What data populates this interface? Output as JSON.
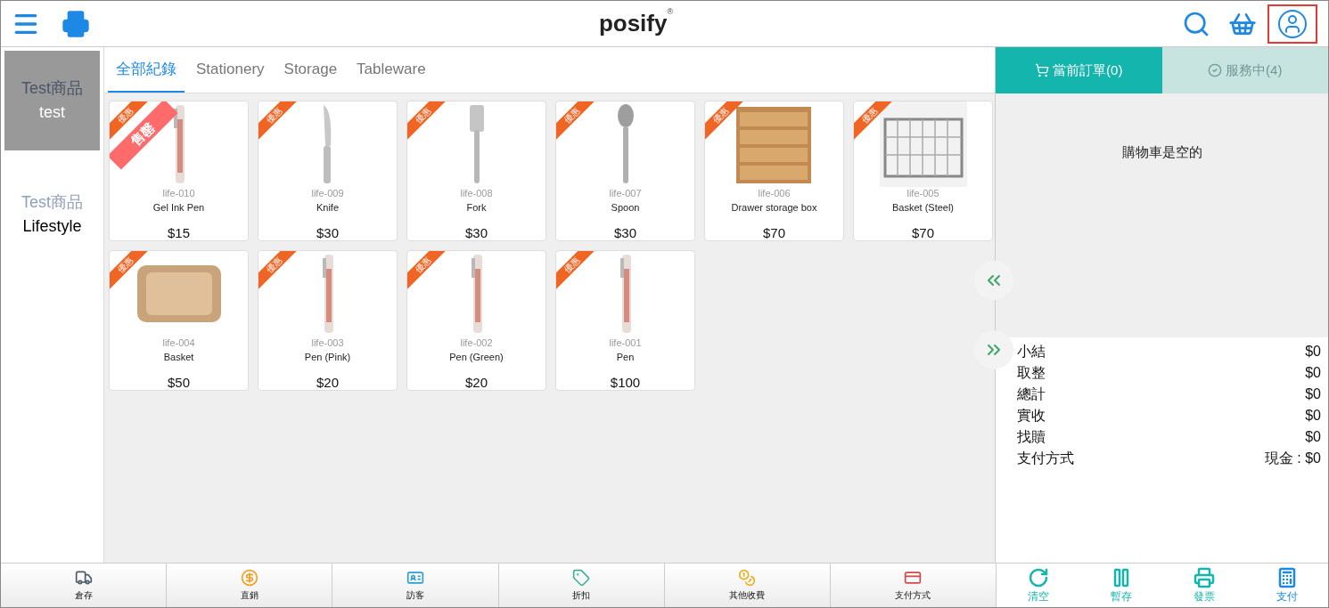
{
  "header": {
    "logo": "posify",
    "logo_mark": "®",
    "user_button": {
      "highlighted": true
    }
  },
  "sidebar": {
    "items": [
      {
        "group": "Test商品",
        "label": "test",
        "selected": true
      },
      {
        "group": "Test商品",
        "label": "Lifestyle",
        "selected": false
      }
    ]
  },
  "tabs": [
    {
      "label": "全部紀錄",
      "selected": true
    },
    {
      "label": "Stationery",
      "selected": false
    },
    {
      "label": "Storage",
      "selected": false
    },
    {
      "label": "Tableware",
      "selected": false
    }
  ],
  "products": [
    {
      "code": "life-010",
      "name": "Gel Ink Pen",
      "price": "$15",
      "kind": "pen",
      "ribbon": "優惠",
      "sold_out": "售罄"
    },
    {
      "code": "life-009",
      "name": "Knife",
      "price": "$30",
      "kind": "knife",
      "ribbon": "優惠"
    },
    {
      "code": "life-008",
      "name": "Fork",
      "price": "$30",
      "kind": "fork",
      "ribbon": "優惠"
    },
    {
      "code": "life-007",
      "name": "Spoon",
      "price": "$30",
      "kind": "spoon",
      "ribbon": "優惠"
    },
    {
      "code": "life-006",
      "name": "Drawer storage box",
      "price": "$70",
      "kind": "drawers",
      "ribbon": "優惠"
    },
    {
      "code": "life-005",
      "name": "Basket (Steel)",
      "price": "$70",
      "kind": "wire",
      "ribbon": "優惠"
    },
    {
      "code": "life-004",
      "name": "Basket",
      "price": "$50",
      "kind": "tray",
      "ribbon": "優惠"
    },
    {
      "code": "life-003",
      "name": "Pen (Pink)",
      "price": "$20",
      "kind": "pen",
      "ribbon": "優惠"
    },
    {
      "code": "life-002",
      "name": "Pen (Green)",
      "price": "$20",
      "kind": "pen",
      "ribbon": "優惠"
    },
    {
      "code": "life-001",
      "name": "Pen",
      "price": "$100",
      "kind": "pen",
      "ribbon": "優惠"
    }
  ],
  "order_tabs": [
    {
      "label": "當前訂單(0)",
      "selected": true
    },
    {
      "label": "服務中(4)",
      "selected": false
    }
  ],
  "cart": {
    "empty_message": "購物車是空的"
  },
  "summary": [
    {
      "label": "小結",
      "value": "$0"
    },
    {
      "label": "取整",
      "value": "$0"
    },
    {
      "label": "總計",
      "value": "$0"
    },
    {
      "label": "實收",
      "value": "$0"
    },
    {
      "label": "找贖",
      "value": "$0"
    },
    {
      "label": "支付方式",
      "value": "現金 : $0"
    }
  ],
  "toolbar": [
    {
      "label": "倉存"
    },
    {
      "label": "直銷"
    },
    {
      "label": "訪客"
    },
    {
      "label": "折扣"
    },
    {
      "label": "其他收費"
    },
    {
      "label": "支付方式"
    }
  ],
  "actions": [
    {
      "label": "清空"
    },
    {
      "label": "暫存"
    },
    {
      "label": "發票"
    },
    {
      "label": "支付"
    }
  ]
}
